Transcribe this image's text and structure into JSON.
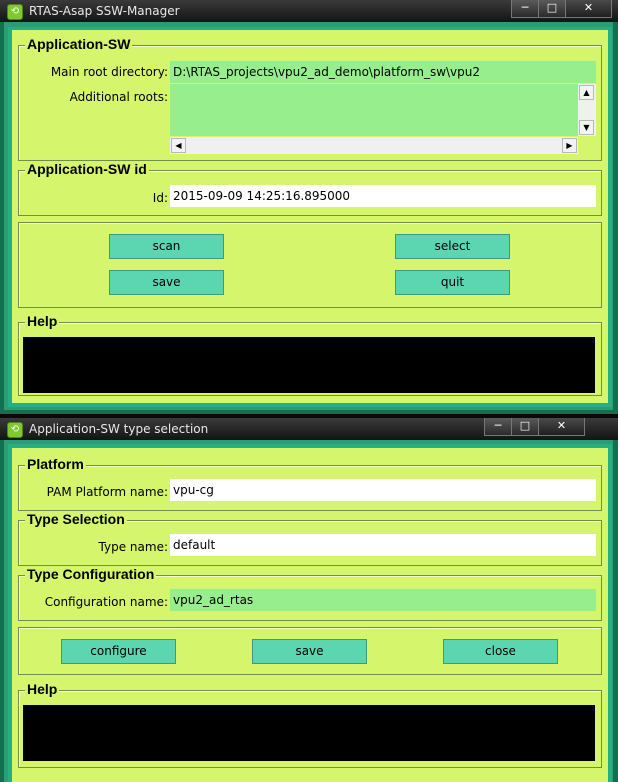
{
  "window1": {
    "title": "RTAS-Asap SSW-Manager",
    "controls": {
      "minimize": "─",
      "maximize": "□",
      "close": "✕"
    },
    "app_sw": {
      "title": "Application-SW",
      "main_root_label": "Main root directory:",
      "main_root_value": "D:\\RTAS_projects\\vpu2_ad_demo\\platform_sw\\vpu2",
      "additional_roots_label": "Additional roots:"
    },
    "app_sw_id": {
      "title": "Application-SW id",
      "id_label": "Id:",
      "id_value": "2015-09-09 14:25:16.895000"
    },
    "buttons": {
      "scan": "scan",
      "select": "select",
      "save": "save",
      "quit": "quit"
    },
    "help": {
      "title": "Help"
    }
  },
  "window2": {
    "title": "Application-SW type selection",
    "controls": {
      "minimize": "─",
      "maximize": "□",
      "close": "✕"
    },
    "platform": {
      "title": "Platform",
      "label": "PAM Platform name:",
      "value": "vpu-cg"
    },
    "type_selection": {
      "title": "Type Selection",
      "label": "Type name:",
      "value": "default"
    },
    "type_configuration": {
      "title": "Type Configuration",
      "label": "Configuration name:",
      "value": "vpu2_ad_rtas"
    },
    "buttons": {
      "configure": "configure",
      "save": "save",
      "close": "close"
    },
    "help": {
      "title": "Help"
    }
  },
  "colors": {
    "panel": "#d4f56c",
    "border_teal": "#24b084",
    "button": "#5cd6b0",
    "readonly_field": "#96ef8c",
    "help_area": "#000000"
  }
}
